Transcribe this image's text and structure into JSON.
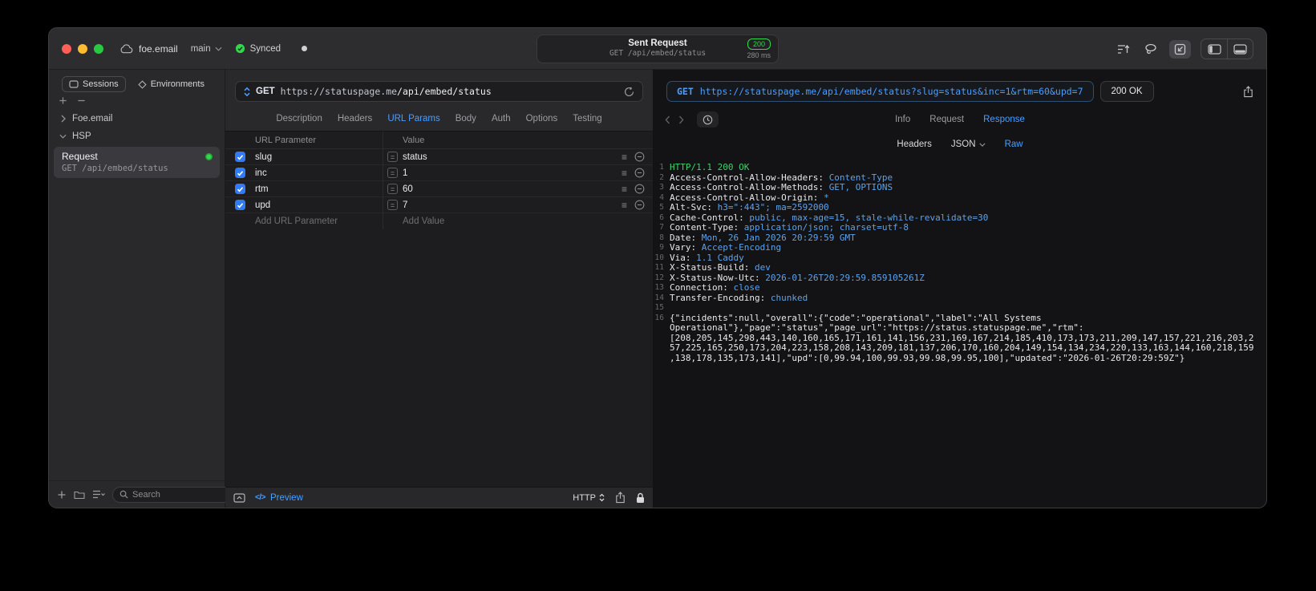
{
  "colors": {
    "accent": "#4a9eff",
    "green": "#32d74b",
    "code-blue": "#5da2ea",
    "code-green": "#3ecf6e",
    "checkbox-blue": "#2f7cf6",
    "traffic-red": "#ff5f57",
    "traffic-yellow": "#febc2e",
    "traffic-green": "#28c840"
  },
  "titlebar": {
    "project": "foe.email",
    "branch": "main",
    "sync_status": "Synced",
    "summary": {
      "title": "Sent Request",
      "status_code": "200",
      "subtitle": "GET /api/embed/status",
      "duration": "280 ms"
    }
  },
  "sidebar": {
    "tabs": [
      {
        "label": "Sessions",
        "active": true
      },
      {
        "label": "Environments",
        "active": false
      }
    ],
    "tree": [
      {
        "label": "Foe.email",
        "expanded": false
      },
      {
        "label": "HSP",
        "expanded": true
      }
    ],
    "request_item": {
      "title": "Request",
      "subtitle": "GET /api/embed/status"
    },
    "search_placeholder": "Search"
  },
  "request": {
    "method": "GET",
    "url_scheme_host": "https://statuspage.me",
    "url_path": "/api/embed/status",
    "tabs": [
      {
        "label": "Description"
      },
      {
        "label": "Headers"
      },
      {
        "label": "URL Params",
        "active": true
      },
      {
        "label": "Body"
      },
      {
        "label": "Auth"
      },
      {
        "label": "Options"
      },
      {
        "label": "Testing"
      }
    ],
    "table": {
      "columns": [
        "URL Parameter",
        "Value"
      ],
      "rows": [
        {
          "enabled": true,
          "name": "slug",
          "value": "status"
        },
        {
          "enabled": true,
          "name": "inc",
          "value": "1"
        },
        {
          "enabled": true,
          "name": "rtm",
          "value": "60"
        },
        {
          "enabled": true,
          "name": "upd",
          "value": "7"
        }
      ],
      "add_name_placeholder": "Add URL Parameter",
      "add_value_placeholder": "Add Value"
    },
    "footer": {
      "preview_label": "Preview",
      "protocol": "HTTP"
    }
  },
  "response": {
    "request_method": "GET",
    "request_url": "https://statuspage.me/api/embed/status?slug=status&inc=1&rtm=60&upd=7",
    "status": "200 OK",
    "tabs": [
      {
        "label": "Info"
      },
      {
        "label": "Request"
      },
      {
        "label": "Response",
        "active": true
      }
    ],
    "subtabs": [
      {
        "label": "Headers"
      },
      {
        "label": "JSON",
        "dropdown": true
      },
      {
        "label": "Raw",
        "active": true
      }
    ],
    "lines": [
      {
        "type": "status",
        "text": "HTTP/1.1 200 OK"
      },
      {
        "type": "header",
        "key": "Access-Control-Allow-Headers",
        "value": "Content-Type"
      },
      {
        "type": "header",
        "key": "Access-Control-Allow-Methods",
        "value": "GET, OPTIONS"
      },
      {
        "type": "header",
        "key": "Access-Control-Allow-Origin",
        "value": "*"
      },
      {
        "type": "header",
        "key": "Alt-Svc",
        "value": "h3=\":443\"; ma=2592000"
      },
      {
        "type": "header",
        "key": "Cache-Control",
        "value": "public, max-age=15, stale-while-revalidate=30"
      },
      {
        "type": "header",
        "key": "Content-Type",
        "value": "application/json; charset=utf-8"
      },
      {
        "type": "header",
        "key": "Date",
        "value": "Mon, 26 Jan 2026 20:29:59 GMT"
      },
      {
        "type": "header",
        "key": "Vary",
        "value": "Accept-Encoding"
      },
      {
        "type": "header",
        "key": "Via",
        "value": "1.1 Caddy"
      },
      {
        "type": "header",
        "key": "X-Status-Build",
        "value": "dev"
      },
      {
        "type": "header",
        "key": "X-Status-Now-Utc",
        "value": "2026-01-26T20:29:59.859105261Z"
      },
      {
        "type": "header",
        "key": "Connection",
        "value": "close"
      },
      {
        "type": "header",
        "key": "Transfer-Encoding",
        "value": "chunked"
      },
      {
        "type": "blank"
      },
      {
        "type": "body",
        "text": "{\"incidents\":null,\"overall\":{\"code\":\"operational\",\"label\":\"All Systems Operational\"},\"page\":\"status\",\"page_url\":\"https://status.statuspage.me\",\"rtm\":[208,205,145,298,443,140,160,165,171,161,141,156,231,169,167,214,185,410,173,173,211,209,147,157,221,216,203,257,225,165,250,173,204,223,158,208,143,209,181,137,206,170,160,204,149,154,134,234,220,133,163,144,160,218,159,138,178,135,173,141],\"upd\":[0,99.94,100,99.93,99.98,99.95,100],\"updated\":\"2026-01-26T20:29:59Z\"}"
      }
    ]
  }
}
